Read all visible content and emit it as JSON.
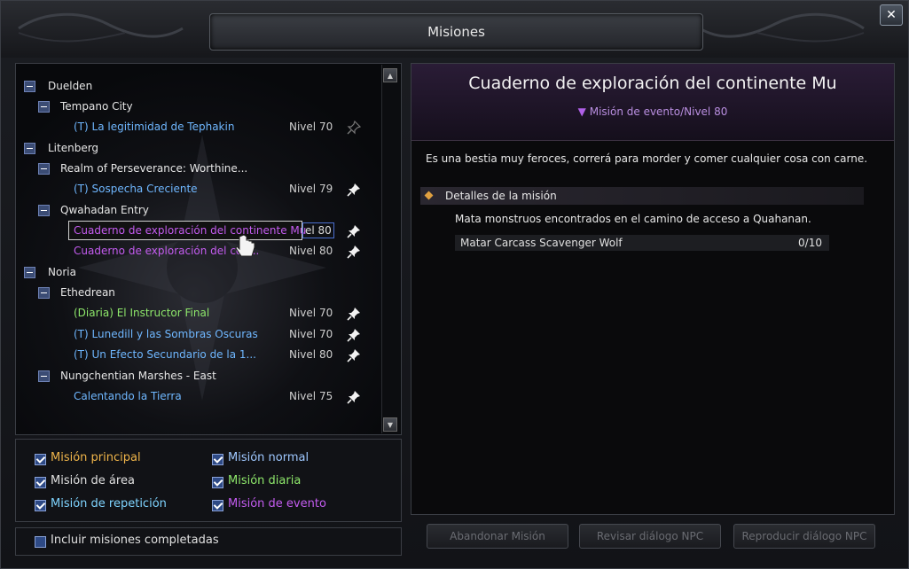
{
  "window": {
    "title": "Misiones",
    "close_glyph": "✕"
  },
  "scroll": {
    "up": "▲",
    "down": "▼"
  },
  "tree": {
    "regions": [
      {
        "name": "Duelden"
      },
      {
        "name": "Litenberg"
      },
      {
        "name": "Noria"
      }
    ],
    "zones": [
      {
        "name": "Tempano City"
      },
      {
        "name": "Realm of Perseverance: Worthine..."
      },
      {
        "name": "Qwahadan Entry"
      },
      {
        "name": "Ethedrean"
      },
      {
        "name": "Nungchentian Marshes - East"
      }
    ],
    "quests": [
      {
        "title": "(T) La legitimidad de Tephakin",
        "level": "Nivel 70"
      },
      {
        "title": "(T) Sospecha Creciente",
        "level": "Nivel 79"
      },
      {
        "title": "Cuaderno de exploración del continente Mu",
        "level": "el 80"
      },
      {
        "title": "Cuaderno de exploración del con...",
        "level": "Nivel 80"
      },
      {
        "title": "(Diaria) El Instructor Final",
        "level": "Nivel 70"
      },
      {
        "title": "(T) Lunedill y las Sombras Oscuras",
        "level": "Nivel 70"
      },
      {
        "title": "(T) Un Efecto Secundario de la 1...",
        "level": "Nivel 80"
      },
      {
        "title": "Calentando la Tierra",
        "level": "Nivel 75"
      }
    ]
  },
  "filters": {
    "main": "Misión principal",
    "normal": "Misión normal",
    "area": "Misión de área",
    "daily": "Misión diaria",
    "repeat": "Misión de repetición",
    "event": "Misión de evento",
    "completed": "Incluir misiones completadas"
  },
  "detail": {
    "title": "Cuaderno de exploración del continente Mu",
    "subtitle": "Misión de evento/Nivel 80",
    "description": "Es una bestia muy feroces, correrá para morder y comer cualquier cosa con carne.",
    "section_label": "Detalles de la misión",
    "objective_text": "Mata monstruos encontrados en el camino de acceso a Quahanan.",
    "objective_name": "Matar Carcass Scavenger Wolf",
    "objective_count": "0/10"
  },
  "buttons": {
    "abandon": "Abandonar Misión",
    "review": "Revisar diálogo NPC",
    "replay": "Reproducir diálogo NPC"
  }
}
